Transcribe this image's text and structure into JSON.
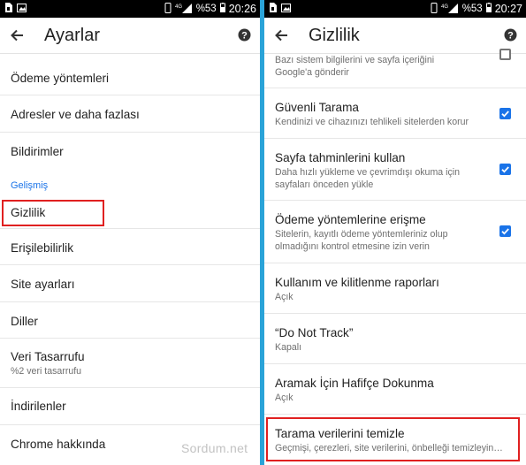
{
  "left": {
    "status": {
      "battery": "%53",
      "network": "4G",
      "time": "20:26"
    },
    "toolbar": {
      "title": "Ayarlar"
    },
    "items": [
      {
        "label": "Ödeme yöntemleri"
      },
      {
        "label": "Adresler ve daha fazlası"
      },
      {
        "label": "Bildirimler"
      }
    ],
    "section_label": "Gelişmiş",
    "advanced_items": [
      {
        "label": "Gizlilik"
      },
      {
        "label": "Erişilebilirlik"
      },
      {
        "label": "Site ayarları"
      },
      {
        "label": "Diller"
      },
      {
        "label": "Veri Tasarrufu",
        "sub": "%2 veri tasarrufu"
      },
      {
        "label": "İndirilenler"
      },
      {
        "label": "Chrome hakkında"
      }
    ],
    "watermark": "Sordum.net"
  },
  "right": {
    "status": {
      "battery": "%53",
      "network": "4G",
      "time": "20:27"
    },
    "toolbar": {
      "title": "Gizlilik"
    },
    "items": [
      {
        "sub1": "Bazı sistem bilgilerini ve sayfa içeriğini",
        "sub2": "Google'a gönderir",
        "checked": false
      },
      {
        "label": "Güvenli Tarama",
        "sub1": "Kendinizi ve cihazınızı tehlikeli sitelerden korur",
        "checked": true
      },
      {
        "label": "Sayfa tahminlerini kullan",
        "sub1": "Daha hızlı yükleme ve çevrimdışı okuma için",
        "sub2": "sayfaları önceden yükle",
        "checked": true
      },
      {
        "label": "Ödeme yöntemlerine erişme",
        "sub1": "Sitelerin, kayıtlı ödeme yöntemleriniz olup",
        "sub2": "olmadığını kontrol etmesine izin verin",
        "checked": true
      },
      {
        "label": "Kullanım ve kilitlenme raporları",
        "sub1": "Açık"
      },
      {
        "label": "“Do Not Track”",
        "sub1": "Kapalı"
      },
      {
        "label": "Aramak İçin Hafifçe Dokunma",
        "sub1": "Açık"
      },
      {
        "label": "Tarama verilerini temizle",
        "sub1": "Geçmişi, çerezleri, site verilerini, önbelleği temizleyin…"
      }
    ]
  },
  "colors": {
    "accent": "#1a73e8",
    "highlight": "#e02020",
    "divider": "#2aa3d8"
  }
}
